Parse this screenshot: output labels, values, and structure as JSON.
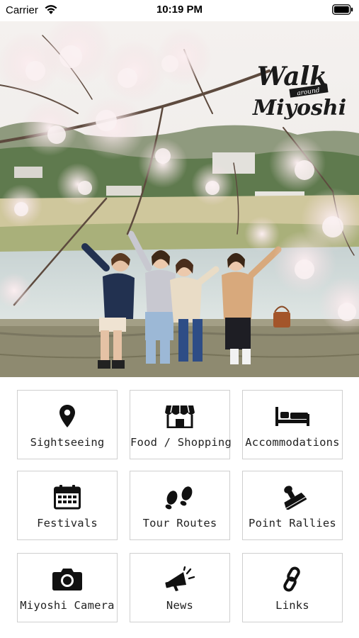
{
  "status_bar": {
    "carrier": "Carrier",
    "time": "10:19 PM"
  },
  "hero": {
    "logo": {
      "line1": "Walk",
      "line2": "around",
      "line3": "Miyoshi"
    }
  },
  "menu": {
    "items": [
      {
        "label": "Sightseeing",
        "icon": "location-pin-icon"
      },
      {
        "label": "Food / Shopping",
        "icon": "storefront-icon"
      },
      {
        "label": "Accommodations",
        "icon": "bed-icon"
      },
      {
        "label": "Festivals",
        "icon": "calendar-icon"
      },
      {
        "label": "Tour Routes",
        "icon": "footprints-icon"
      },
      {
        "label": "Point Rallies",
        "icon": "stamp-icon"
      },
      {
        "label": "Miyoshi Camera",
        "icon": "camera-icon"
      },
      {
        "label": "News",
        "icon": "megaphone-icon"
      },
      {
        "label": "Links",
        "icon": "link-icon"
      }
    ]
  }
}
